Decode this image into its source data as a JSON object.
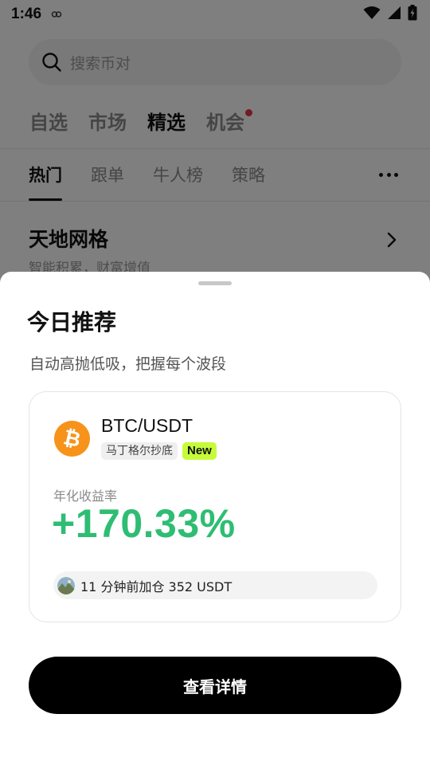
{
  "status_bar": {
    "time": "1:46"
  },
  "search": {
    "placeholder": "搜索币对"
  },
  "top_tabs": [
    {
      "label": "自选",
      "active": false
    },
    {
      "label": "市场",
      "active": false
    },
    {
      "label": "精选",
      "active": true
    },
    {
      "label": "机会",
      "active": false,
      "has_dot": true
    }
  ],
  "sub_tabs": [
    {
      "label": "热门",
      "active": true
    },
    {
      "label": "跟单",
      "active": false
    },
    {
      "label": "牛人榜",
      "active": false
    },
    {
      "label": "策略",
      "active": false
    }
  ],
  "section": {
    "title": "天地网格",
    "subtitle": "智能积累，财富增值"
  },
  "sheet": {
    "title": "今日推荐",
    "subtitle": "自动高抛低吸，把握每个波段",
    "card": {
      "pair": "BTC/USDT",
      "tag_strategy": "马丁格尔抄底",
      "tag_new": "New",
      "yield_label": "年化收益率",
      "yield_value": "+170.33%",
      "activity": "11 分钟前加仓 352 USDT"
    },
    "button_label": "查看详情"
  },
  "colors": {
    "accent_green": "#2ebd73",
    "new_tag": "#c5fb3a",
    "btc_orange": "#f7931a",
    "notify_dot": "#e8344a"
  },
  "icons": {
    "search": "search-icon",
    "more": "more-dots-icon",
    "chevron": "chevron-right-icon",
    "coin": "bitcoin-icon"
  }
}
